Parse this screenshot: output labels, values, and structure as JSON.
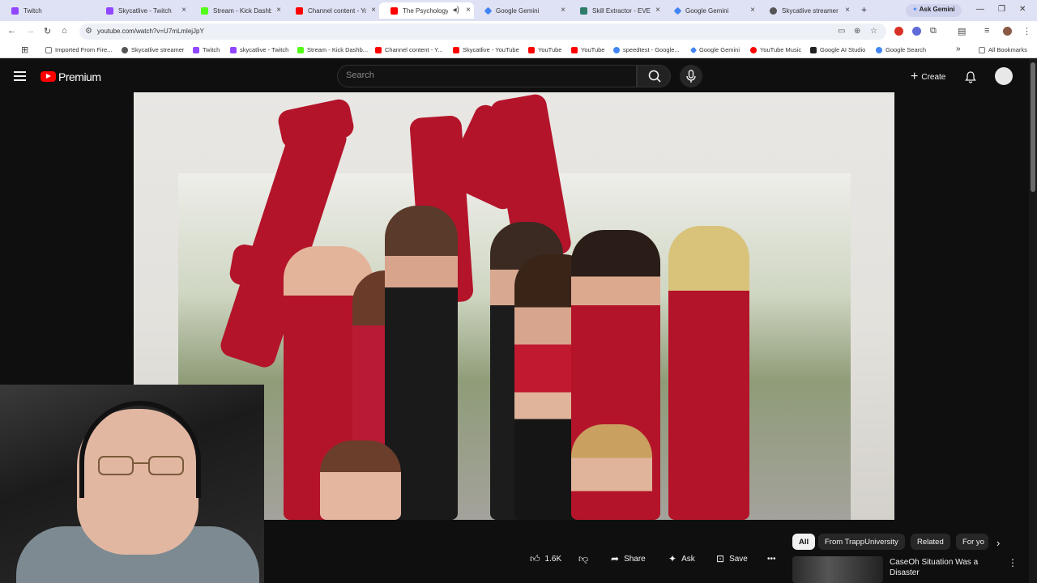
{
  "browser": {
    "tabs": [
      {
        "label": "Twitch",
        "color": "#9146ff"
      },
      {
        "label": "Skycatlive - Twitch",
        "color": "#9146ff"
      },
      {
        "label": "Stream - Kick Dashbo",
        "color": "#53fc18"
      },
      {
        "label": "Channel content - Yo",
        "color": "#ff0000"
      },
      {
        "label": "The Psychology o",
        "color": "#ff0000",
        "active": true
      },
      {
        "label": "Google Gemini",
        "color": "#4285f4"
      },
      {
        "label": "Skill Extractor - EVE T",
        "color": "#2e7d6b"
      },
      {
        "label": "Google Gemini",
        "color": "#4285f4"
      },
      {
        "label": "Skycatlive streamer",
        "color": "#555555"
      }
    ],
    "new_tab": "+",
    "ask_gemini": "Ask Gemini",
    "url": "youtube.com/watch?v=U7mLmlejJpY",
    "bookmarks": [
      {
        "label": "Imported From Fire...",
        "icon": "folder-icon",
        "color": "#777777"
      },
      {
        "label": "Skycatlive streamer",
        "icon": "globe-icon",
        "color": "#555555"
      },
      {
        "label": "Twitch",
        "icon": "twitch-icon",
        "color": "#9146ff"
      },
      {
        "label": "skycatlive - Twitch",
        "icon": "twitch-icon",
        "color": "#9146ff"
      },
      {
        "label": "Stream - Kick Dashb...",
        "icon": "kick-icon",
        "color": "#53fc18"
      },
      {
        "label": "Channel content - Y...",
        "icon": "youtube-icon",
        "color": "#ff0000"
      },
      {
        "label": "Skycatlive - YouTube",
        "icon": "youtube-icon",
        "color": "#ff0000"
      },
      {
        "label": "YouTube",
        "icon": "youtube-icon",
        "color": "#ff0000"
      },
      {
        "label": "YouTube",
        "icon": "youtube-icon",
        "color": "#ff0000"
      },
      {
        "label": "speedtest - Google...",
        "icon": "google-icon",
        "color": "#4285f4"
      },
      {
        "label": "Google Gemini",
        "icon": "gemini-icon",
        "color": "#4285f4"
      },
      {
        "label": "YouTube Music",
        "icon": "youtube-music-icon",
        "color": "#ff0000"
      },
      {
        "label": "Google AI Studio",
        "icon": "ai-studio-icon",
        "color": "#222222"
      },
      {
        "label": "Google Search",
        "icon": "google-icon",
        "color": "#4285f4"
      }
    ],
    "more_bookmarks": "»",
    "all_bookmarks": "All Bookmarks"
  },
  "youtube": {
    "brand": "Premium",
    "search_placeholder": "Search",
    "create_label": "Create",
    "actions": {
      "like_count": "1.6K",
      "share": "Share",
      "ask": "Ask",
      "save": "Save"
    },
    "chips": [
      "All",
      "From TrappUniversity",
      "Related",
      "For yo"
    ],
    "recommendation": {
      "title": "CaseOh Situation Was a Disaster"
    }
  },
  "colors": {
    "youtube_red": "#ff0000",
    "dark_bg": "#0f0f0f",
    "jacket_red": "#b3142a"
  }
}
